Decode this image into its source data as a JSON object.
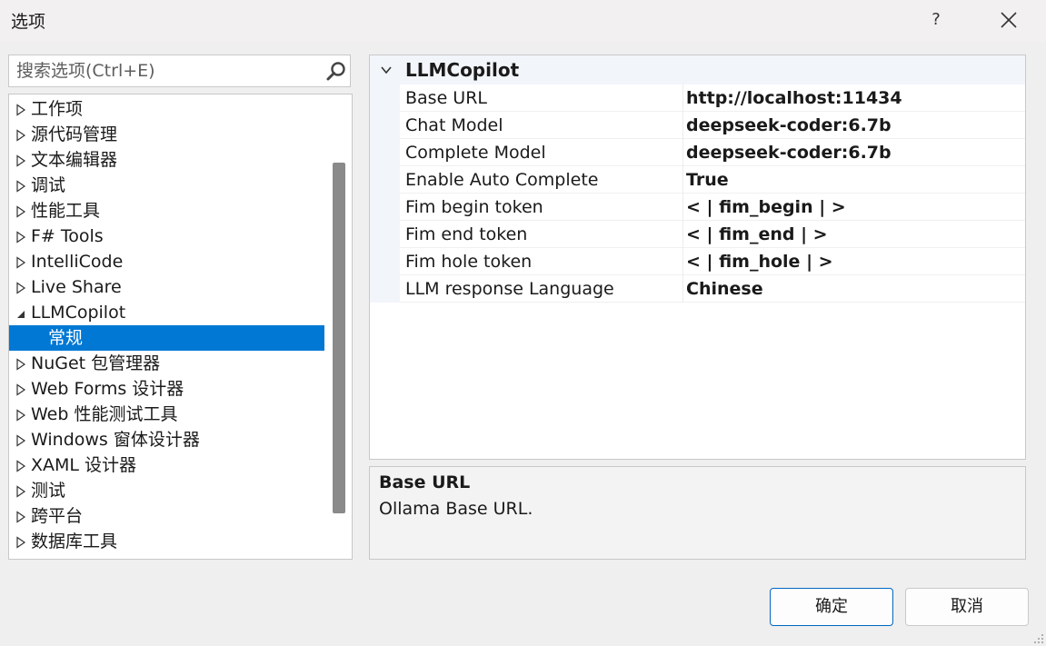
{
  "window": {
    "title": "选项",
    "help_label": "?"
  },
  "search": {
    "placeholder": "搜索选项(Ctrl+E)",
    "value": ""
  },
  "tree": {
    "items": [
      {
        "label": "工作项",
        "expanded": false
      },
      {
        "label": "源代码管理",
        "expanded": false
      },
      {
        "label": "文本编辑器",
        "expanded": false
      },
      {
        "label": "调试",
        "expanded": false
      },
      {
        "label": "性能工具",
        "expanded": false
      },
      {
        "label": "F# Tools",
        "expanded": false
      },
      {
        "label": "IntelliCode",
        "expanded": false
      },
      {
        "label": "Live Share",
        "expanded": false
      },
      {
        "label": "LLMCopilot",
        "expanded": true
      },
      {
        "label": "常规",
        "child": true,
        "selected": true
      },
      {
        "label": "NuGet 包管理器",
        "expanded": false
      },
      {
        "label": "Web Forms 设计器",
        "expanded": false
      },
      {
        "label": "Web 性能测试工具",
        "expanded": false
      },
      {
        "label": "Windows 窗体设计器",
        "expanded": false
      },
      {
        "label": "XAML 设计器",
        "expanded": false
      },
      {
        "label": "测试",
        "expanded": false
      },
      {
        "label": "跨平台",
        "expanded": false
      },
      {
        "label": "数据库工具",
        "expanded": false
      }
    ]
  },
  "properties": {
    "category": "LLMCopilot",
    "rows": [
      {
        "name": "Base URL",
        "value": "http://localhost:11434"
      },
      {
        "name": "Chat Model",
        "value": "deepseek-coder:6.7b"
      },
      {
        "name": "Complete Model",
        "value": "deepseek-coder:6.7b"
      },
      {
        "name": "Enable Auto Complete",
        "value": "True"
      },
      {
        "name": "Fim begin token",
        "value": "< | fim_begin | >"
      },
      {
        "name": "Fim end token",
        "value": "< | fim_end | >"
      },
      {
        "name": "Fim hole token",
        "value": "< | fim_hole | >"
      },
      {
        "name": "LLM response Language",
        "value": "Chinese"
      }
    ]
  },
  "description": {
    "title": "Base URL",
    "text": "Ollama Base URL."
  },
  "buttons": {
    "ok": "确定",
    "cancel": "取消"
  },
  "colors": {
    "selection": "#0078d4",
    "ok_border": "#0067c0"
  }
}
